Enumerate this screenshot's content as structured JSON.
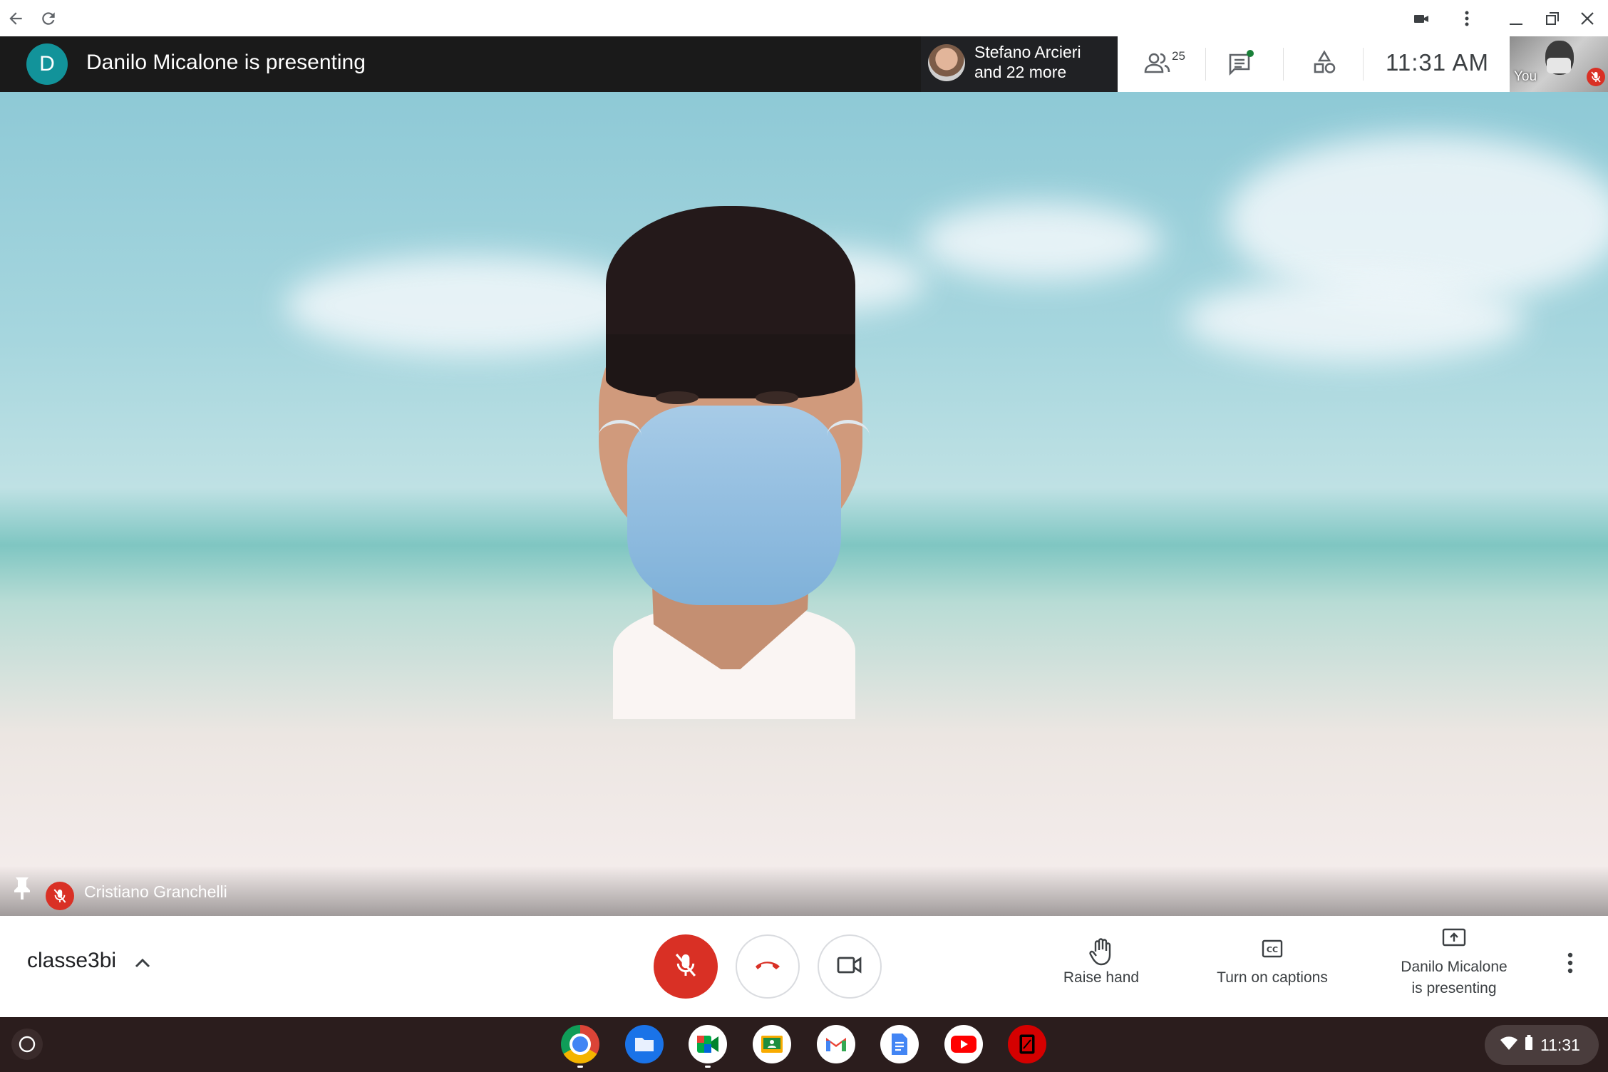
{
  "window": {
    "title_bar": {
      "back": "back-arrow",
      "reload": "reload"
    }
  },
  "presenting_bar": {
    "avatar_letter": "D",
    "title": "Danilo Micalone is presenting"
  },
  "active_speaker": {
    "name": "Stefano Arcieri",
    "more": "and 22 more"
  },
  "top_controls": {
    "participants_count": "25",
    "clock": "11:31  AM"
  },
  "self_tile": {
    "label": "You"
  },
  "video": {
    "participant_name": "Cristiano Granchelli"
  },
  "control_bar": {
    "meeting_name": "classe3bi",
    "raise_hand": "Raise hand",
    "captions": "Turn on captions",
    "presenting_line1": "Danilo Micalone",
    "presenting_line2": "is presenting"
  },
  "shelf": {
    "apps": [
      "chrome-icon",
      "files-icon",
      "meet-icon",
      "classroom-icon",
      "gmail-icon",
      "docs-icon",
      "youtube-icon",
      "pdf-app-icon"
    ],
    "time": "11:31"
  },
  "colors": {
    "red": "#d93025",
    "teal_avatar": "#12939a",
    "shelf": "#2b1d1d"
  }
}
